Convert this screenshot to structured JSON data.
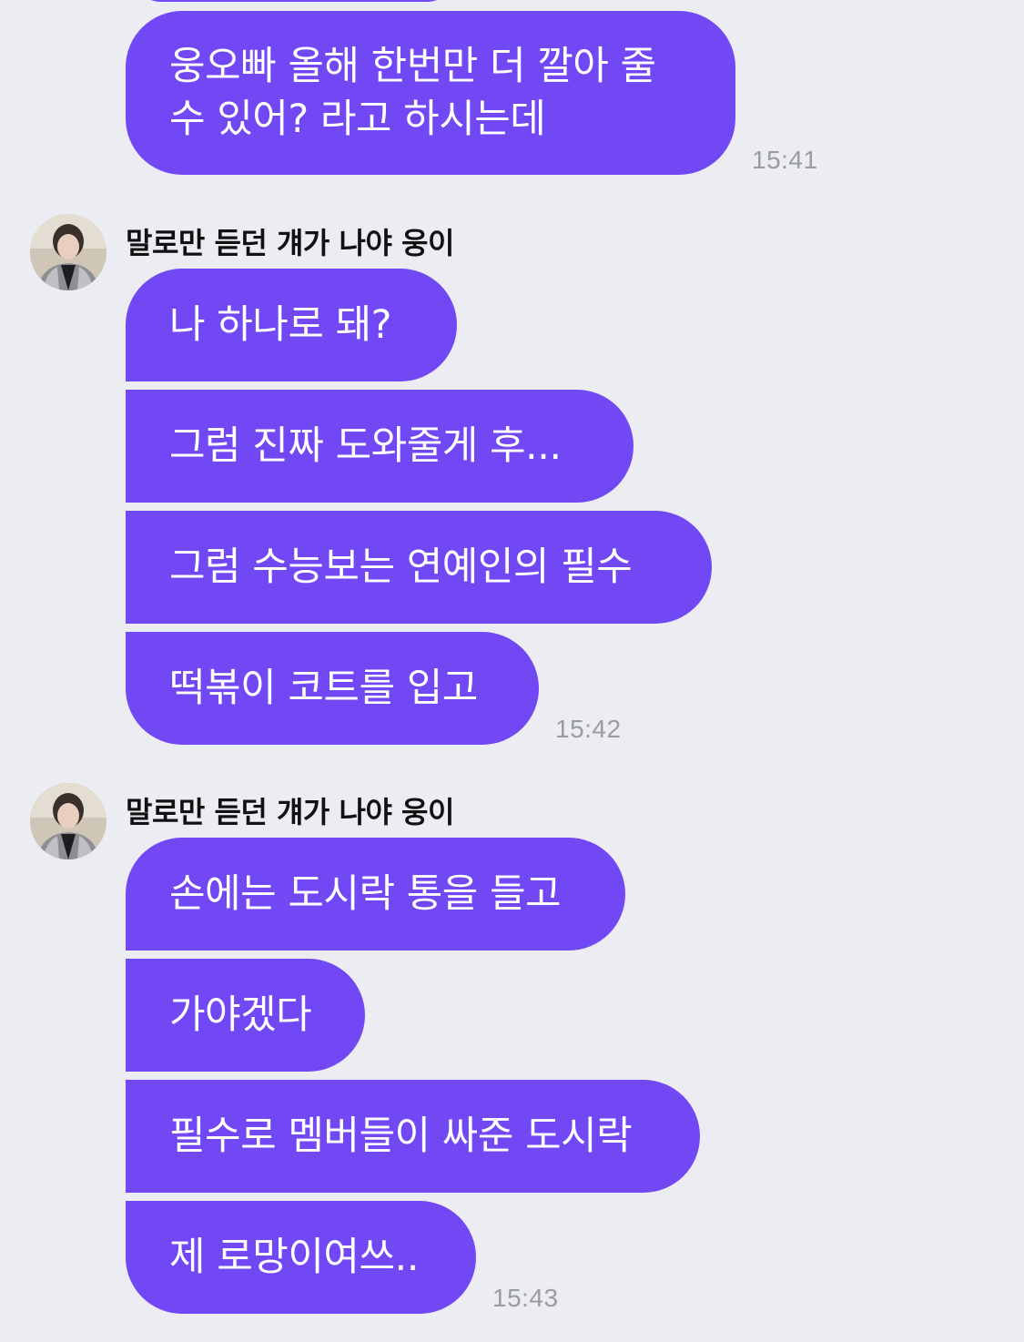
{
  "conversation": {
    "block1": {
      "message": "웅오빠 올해 한번만 더 깔아 줄 수 있어? 라고 하시는데",
      "time": "15:41"
    },
    "block2": {
      "sender": "말로만 듣던 걔가 나야 웅이",
      "messages": [
        "나 하나로 돼?",
        "그럼 진짜 도와줄게 후...",
        "그럼 수능보는 연예인의 필수",
        "떡볶이 코트를 입고"
      ],
      "time": "15:42"
    },
    "block3": {
      "sender": "말로만 듣던 걔가 나야 웅이",
      "messages": [
        "손에는 도시락 통을 들고",
        "가야겠다",
        "필수로 멤버들이 싸준 도시락",
        "제 로망이여쓰.."
      ],
      "time": "15:43"
    }
  },
  "colors": {
    "background": "#ecedf2",
    "bubble": "#7248f5",
    "time": "#9a9ca3"
  }
}
